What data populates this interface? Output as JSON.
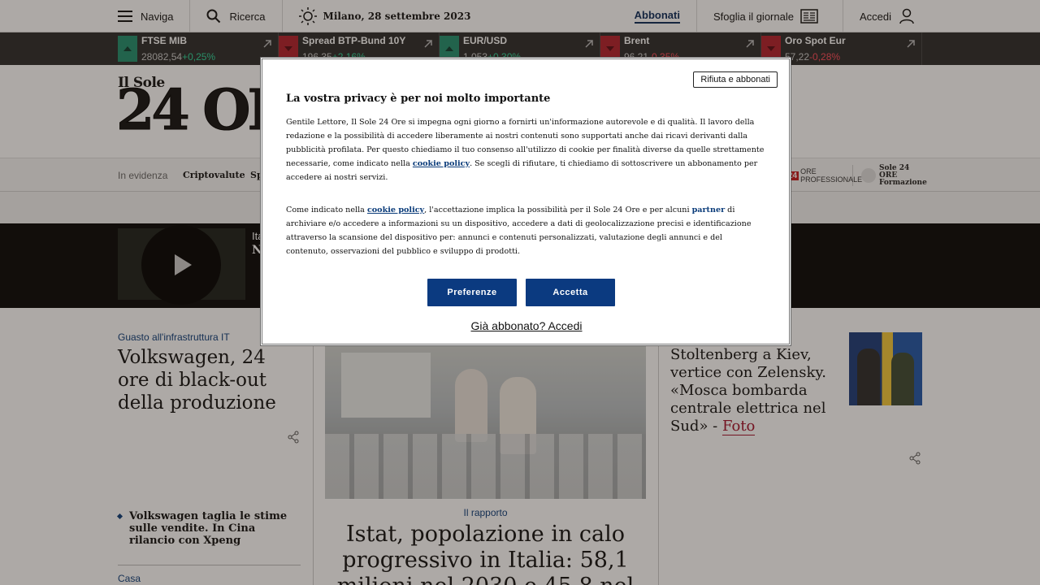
{
  "topbar": {
    "naviga": "Naviga",
    "ricerca": "Ricerca",
    "date": "Milano, 28 settembre 2023",
    "abbonati": "Abbonati",
    "sfoglia": "Sfoglia il giornale",
    "accedi": "Accedi"
  },
  "ticker": [
    {
      "name": "FTSE MIB",
      "value": "28082,54",
      "change": "+0,25%",
      "direction": "up"
    },
    {
      "name": "Spread BTP-Bund 10Y",
      "value": "196,35",
      "change": "+2,16%",
      "direction": "down"
    },
    {
      "name": "EUR/USD",
      "value": "1,053",
      "change": "+0,30%",
      "direction": "up"
    },
    {
      "name": "Brent",
      "value": "96,21",
      "change": "-0,35%",
      "direction": "down"
    },
    {
      "name": "Oro Spot Eur",
      "value": "57,22",
      "change": "-0,28%",
      "direction": "down"
    }
  ],
  "masthead": {
    "logo_small": "Il Sole",
    "logo_big": "24 ORE"
  },
  "evidenza": {
    "label": "In evidenza",
    "items": [
      "Criptovalute",
      "Sp"
    ],
    "brand1_red": "24",
    "brand1": "ORE PROFESSIONALE",
    "brand2": "Sole 24 ORE Formazione"
  },
  "video": {
    "kicker": "Ita",
    "title": "N"
  },
  "left": {
    "kicker": "Guasto all'infrastruttura IT",
    "headline": "Volkswagen, 24 ore di black-out della produzione",
    "bullet": "Volkswagen taglia le stime sulle vendite. In Cina rilancio con Xpeng",
    "kicker2": "Casa"
  },
  "mid": {
    "kicker": "Il rapporto",
    "headline": "Istat, popolazione in calo progressivo in Italia: 58,1 milioni nel 2030 e 45,8 nel"
  },
  "right": {
    "headline": "Stoltenberg a Kiev, vertice con Zelensky. «Mosca bombarda centrale elettrica nel Sud» - ",
    "foto": "Foto"
  },
  "modal": {
    "refuse": "Rifiuta e abbonati",
    "title": "La vostra privacy è per noi molto importante",
    "p1_a": "Gentile Lettore, Il Sole 24 Ore si impegna ogni giorno a fornirti un'informazione autorevole e di qualità. Il lavoro della redazione e la possibilità di accedere liberamente ai nostri contenuti sono supportati anche dai ricavi derivanti dalla pubblicità profilata. Per questo chiediamo il tuo consenso all'utilizzo di cookie per finalità diverse da quelle strettamente necessarie, come indicato nella ",
    "p1_link": "cookie policy",
    "p1_b": ". Se scegli di rifiutare, ti chiediamo di sottoscrivere un abbonamento per accedere ai nostri servizi.",
    "p2_a": "Come indicato nella ",
    "p2_link": "cookie policy",
    "p2_b": ", l'accettazione implica la possibilità per il Sole 24 Ore e per alcuni ",
    "p2_link2": "partner",
    "p2_c": " di archiviare e/o accedere a informazioni su un dispositivo, accedere a dati di geolocalizzazione precisi e identificazione attraverso la scansione del dispositivo per: annunci e contenuti personalizzati, valutazione degli annunci e del contenuto, osservazioni del pubblico e sviluppo di prodotti.",
    "btn_pref": "Preferenze",
    "btn_acc": "Accetta",
    "login": "Già abbonato? Accedi"
  }
}
